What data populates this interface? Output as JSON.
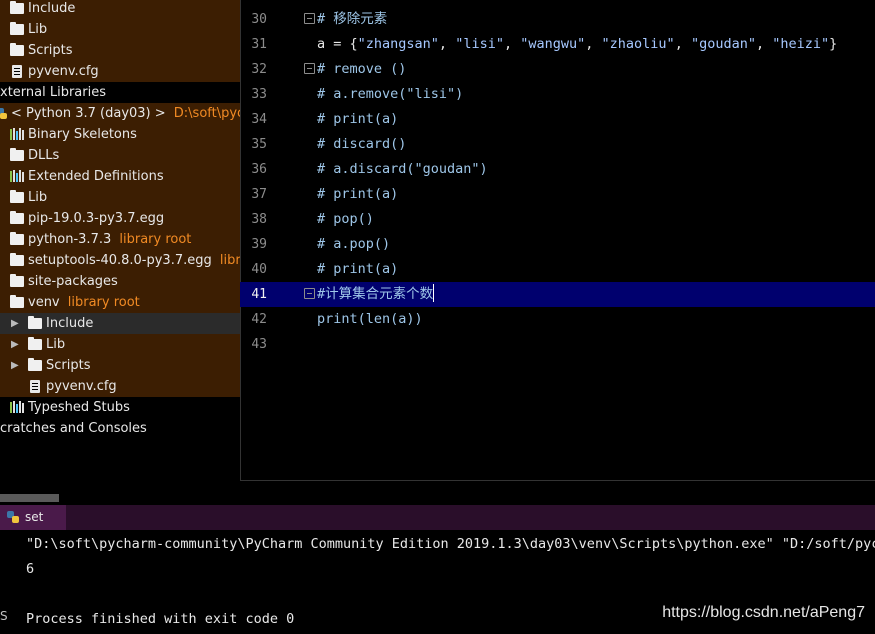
{
  "project_tree": [
    {
      "label": "Include",
      "icon": "folder-icon",
      "indent": 10,
      "hint": ""
    },
    {
      "label": "Lib",
      "icon": "folder-icon",
      "indent": 10,
      "hint": ""
    },
    {
      "label": "Scripts",
      "icon": "folder-icon",
      "indent": 10,
      "hint": ""
    },
    {
      "label": "pyvenv.cfg",
      "icon": "file-icon",
      "indent": 10,
      "hint": ""
    },
    {
      "label": "xternal Libraries",
      "icon": "",
      "indent": 0,
      "hint": ""
    },
    {
      "label": "< Python 3.7 (day03) >",
      "icon": "python-icon",
      "indent": 0,
      "hint": "D:\\soft\\pycharm"
    },
    {
      "label": "Binary Skeletons",
      "icon": "library-icon",
      "indent": 10,
      "hint": ""
    },
    {
      "label": "DLLs",
      "icon": "folder-icon",
      "indent": 10,
      "hint": ""
    },
    {
      "label": "Extended Definitions",
      "icon": "library-icon",
      "indent": 10,
      "hint": ""
    },
    {
      "label": "Lib",
      "icon": "folder-icon",
      "indent": 10,
      "hint": ""
    },
    {
      "label": "pip-19.0.3-py3.7.egg",
      "icon": "folder-icon",
      "indent": 10,
      "hint": ""
    },
    {
      "label": "python-3.7.3",
      "icon": "folder-icon",
      "indent": 10,
      "hint": "library root"
    },
    {
      "label": "setuptools-40.8.0-py3.7.egg",
      "icon": "folder-icon",
      "indent": 10,
      "hint": "library r"
    },
    {
      "label": "site-packages",
      "icon": "folder-icon",
      "indent": 10,
      "hint": ""
    },
    {
      "label": "venv",
      "icon": "folder-icon",
      "indent": 10,
      "hint": "library root"
    },
    {
      "label": "Include",
      "icon": "folder-icon",
      "indent": 28,
      "hint": ""
    },
    {
      "label": "Lib",
      "icon": "folder-icon",
      "indent": 28,
      "hint": ""
    },
    {
      "label": "Scripts",
      "icon": "folder-icon",
      "indent": 28,
      "hint": ""
    },
    {
      "label": "pyvenv.cfg",
      "icon": "file-icon",
      "indent": 28,
      "hint": ""
    },
    {
      "label": "Typeshed Stubs",
      "icon": "library-icon",
      "indent": 10,
      "hint": ""
    },
    {
      "label": "cratches and Consoles",
      "icon": "",
      "indent": 0,
      "hint": ""
    }
  ],
  "editor": {
    "lines": [
      {
        "n": "30",
        "text": "# 移除元素",
        "kind": "comment"
      },
      {
        "n": "31",
        "text": "a = {\"zhangsan\", \"lisi\", \"wangwu\", \"zhaoliu\", \"goudan\", \"heizi\"}",
        "kind": "assign"
      },
      {
        "n": "32",
        "text": "# remove ()",
        "kind": "comment"
      },
      {
        "n": "33",
        "text": "# a.remove(\"lisi\")",
        "kind": "comment"
      },
      {
        "n": "34",
        "text": "# print(a)",
        "kind": "comment"
      },
      {
        "n": "35",
        "text": "# discard()",
        "kind": "comment"
      },
      {
        "n": "36",
        "text": "# a.discard(\"goudan\")",
        "kind": "comment"
      },
      {
        "n": "37",
        "text": "# print(a)",
        "kind": "comment"
      },
      {
        "n": "38",
        "text": "# pop()",
        "kind": "comment"
      },
      {
        "n": "39",
        "text": "# a.pop()",
        "kind": "comment"
      },
      {
        "n": "40",
        "text": "# print(a)",
        "kind": "comment"
      },
      {
        "n": "41",
        "text": "#计算集合元素个数",
        "kind": "comment"
      },
      {
        "n": "42",
        "text": "print(len(a))",
        "kind": "code"
      },
      {
        "n": "43",
        "text": "",
        "kind": "code"
      }
    ],
    "current_line": "41"
  },
  "run": {
    "tab_label": "set",
    "console": [
      "\"D:\\soft\\pycharm-community\\PyCharm Community Edition 2019.1.3\\day03\\venv\\Scripts\\python.exe\" \"D:/soft/pych",
      "6",
      "",
      "Process finished with exit code 0"
    ],
    "left_marker": "S"
  },
  "watermark": "https://blog.csdn.net/aPeng7",
  "colors": {
    "tree_branch": "#3c1e02",
    "current_line": "#00006e",
    "hint": "#f08a24",
    "run_tab": "#4a1a4a"
  }
}
